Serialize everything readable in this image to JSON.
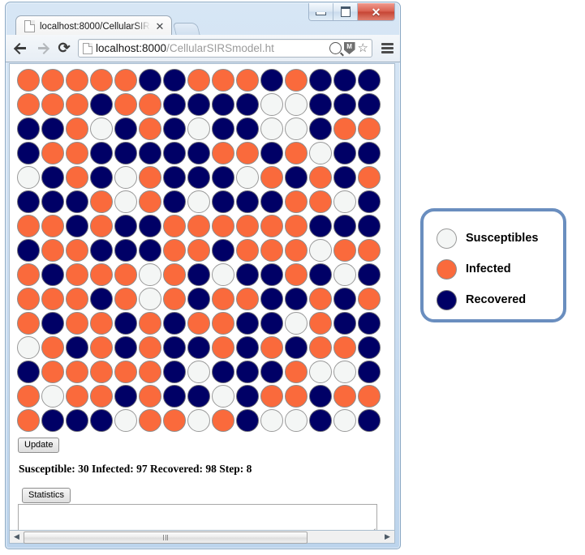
{
  "window": {
    "controls": {
      "minimize_label": "–",
      "maximize_label": "",
      "close_label": "✕"
    }
  },
  "tab": {
    "title": "localhost:8000/CellularSIR",
    "close_label": "✕"
  },
  "toolbar": {
    "back_label": "",
    "forward_label": "",
    "reload_label": "⟳",
    "url_host": "localhost:8000",
    "url_path": "/CellularSIRSmodel.ht",
    "shield_letter": "M",
    "star_label": "☆"
  },
  "page": {
    "update_button": "Update",
    "status": "Susceptible: 30 Infected: 97 Recovered: 98 Step: 8",
    "statistics_button": "Statistics",
    "statistics_value": "",
    "statistics_placeholder": ""
  },
  "legend": {
    "items": [
      {
        "state": "S",
        "label": "Susceptibles"
      },
      {
        "state": "I",
        "label": "Infected"
      },
      {
        "state": "R",
        "label": "Recovered"
      }
    ]
  },
  "colors": {
    "susceptible": "#f4f6f5",
    "infected": "#fa6a3c",
    "recovered": "#000066",
    "legend_border": "#6a8ebf"
  },
  "chart_data": {
    "type": "heatmap",
    "title": "Cellular SIRS model grid",
    "rows": 15,
    "cols": 15,
    "legend": [
      "Susceptibles",
      "Infected",
      "Recovered"
    ],
    "state_codes": [
      "S",
      "I",
      "R"
    ],
    "counts": {
      "Susceptible": 30,
      "Infected": 97,
      "Recovered": 98,
      "Step": 8
    },
    "grid": [
      [
        "I",
        "I",
        "I",
        "I",
        "I",
        "R",
        "R",
        "I",
        "I",
        "I",
        "R",
        "I",
        "R",
        "R",
        "R"
      ],
      [
        "I",
        "I",
        "I",
        "R",
        "I",
        "I",
        "R",
        "R",
        "R",
        "R",
        "S",
        "S",
        "R",
        "R",
        "R"
      ],
      [
        "R",
        "R",
        "I",
        "S",
        "R",
        "I",
        "R",
        "S",
        "R",
        "R",
        "S",
        "S",
        "R",
        "I",
        "I"
      ],
      [
        "R",
        "I",
        "I",
        "R",
        "R",
        "R",
        "R",
        "R",
        "I",
        "I",
        "R",
        "I",
        "S",
        "R",
        "R"
      ],
      [
        "S",
        "R",
        "I",
        "R",
        "S",
        "I",
        "R",
        "R",
        "R",
        "S",
        "I",
        "R",
        "I",
        "R",
        "I"
      ],
      [
        "R",
        "R",
        "R",
        "I",
        "S",
        "I",
        "R",
        "S",
        "R",
        "R",
        "R",
        "I",
        "I",
        "S",
        "R"
      ],
      [
        "I",
        "I",
        "R",
        "I",
        "R",
        "R",
        "I",
        "I",
        "I",
        "I",
        "I",
        "I",
        "R",
        "R",
        "R"
      ],
      [
        "R",
        "I",
        "I",
        "R",
        "R",
        "R",
        "I",
        "I",
        "R",
        "I",
        "I",
        "I",
        "S",
        "I",
        "I"
      ],
      [
        "I",
        "R",
        "I",
        "I",
        "I",
        "S",
        "I",
        "R",
        "S",
        "R",
        "R",
        "I",
        "R",
        "S",
        "R"
      ],
      [
        "I",
        "I",
        "I",
        "R",
        "I",
        "S",
        "I",
        "R",
        "I",
        "I",
        "R",
        "R",
        "I",
        "R",
        "I"
      ],
      [
        "I",
        "R",
        "I",
        "I",
        "R",
        "I",
        "R",
        "I",
        "I",
        "R",
        "R",
        "S",
        "I",
        "R",
        "R"
      ],
      [
        "S",
        "I",
        "R",
        "I",
        "R",
        "I",
        "R",
        "R",
        "I",
        "R",
        "I",
        "R",
        "I",
        "I",
        "R"
      ],
      [
        "R",
        "I",
        "I",
        "I",
        "I",
        "I",
        "R",
        "S",
        "R",
        "R",
        "R",
        "I",
        "S",
        "S",
        "R"
      ],
      [
        "I",
        "S",
        "I",
        "I",
        "R",
        "I",
        "R",
        "R",
        "S",
        "R",
        "I",
        "I",
        "R",
        "I",
        "I"
      ],
      [
        "I",
        "R",
        "R",
        "R",
        "S",
        "I",
        "I",
        "S",
        "I",
        "R",
        "S",
        "S",
        "R",
        "S",
        "R"
      ]
    ]
  },
  "scrollbar": {
    "left_arrow": "◀",
    "right_arrow": "▶"
  }
}
